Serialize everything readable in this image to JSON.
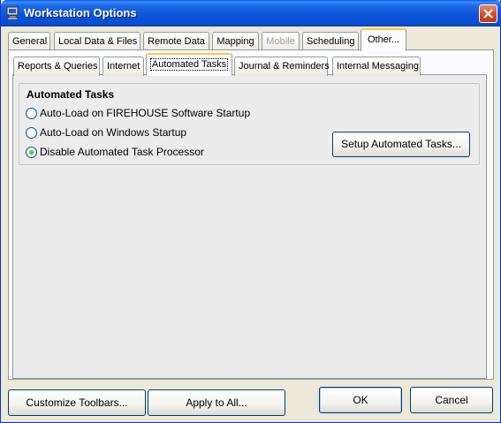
{
  "window": {
    "title": "Workstation Options"
  },
  "tabs_row1": [
    {
      "label": "General",
      "mn": "G",
      "state": "normal"
    },
    {
      "label": "Local Data & Files",
      "mn": "L",
      "state": "normal"
    },
    {
      "label": "Remote Data",
      "mn": "R",
      "state": "normal"
    },
    {
      "label": "Mapping",
      "mn": "M",
      "state": "normal"
    },
    {
      "label": "Mobile",
      "mn": "M",
      "state": "disabled"
    },
    {
      "label": "Scheduling",
      "mn": "S",
      "state": "normal"
    },
    {
      "label": "Other...",
      "mn": "O",
      "state": "active"
    }
  ],
  "tabs_row2": [
    {
      "label": "Reports & Queries",
      "state": "normal"
    },
    {
      "label": "Internet",
      "state": "normal"
    },
    {
      "label": "Automated Tasks",
      "state": "active"
    },
    {
      "label": "Journal & Reminders",
      "state": "normal"
    },
    {
      "label": "Internal Messaging",
      "state": "normal"
    }
  ],
  "group": {
    "title": "Automated Tasks",
    "options": [
      {
        "label": "Auto-Load on FIREHOUSE Software Startup",
        "checked": false
      },
      {
        "label": "Auto-Load on Windows Startup",
        "checked": false
      },
      {
        "label": "Disable Automated Task Processor",
        "checked": true
      }
    ],
    "setup_button": "Setup Automated Tasks..."
  },
  "footer": {
    "customize_toolbars": "Customize Toolbars...",
    "apply_to_all": "Apply to All...",
    "ok": "OK",
    "cancel": "Cancel"
  },
  "icons": {
    "app": "computer-monitor-icon",
    "close": "close-x-icon"
  },
  "colors": {
    "titlebar": "#0a52d8",
    "active_tab_accent": "#ffc83c",
    "close_button": "#d6502a"
  }
}
